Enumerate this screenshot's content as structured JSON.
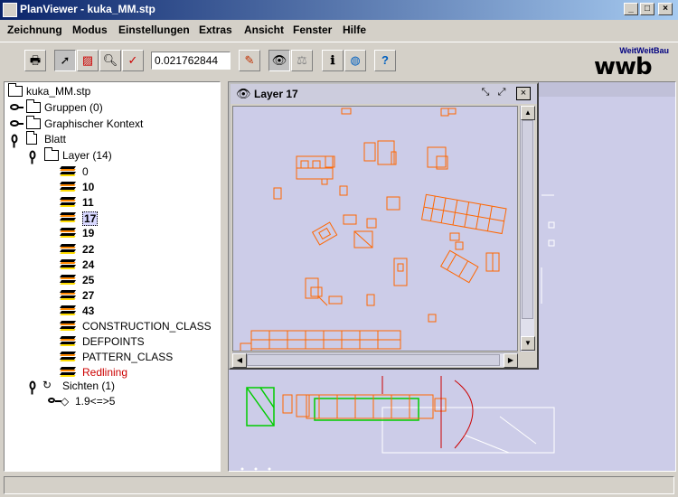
{
  "window": {
    "title": "PlanViewer - kuka_MM.stp"
  },
  "menu": [
    "Zeichnung",
    "Modus",
    "Einstellungen",
    "Extras",
    "Ansicht",
    "Fenster",
    "Hilfe"
  ],
  "toolbar": {
    "zoom_value": "0.021762844",
    "logo_small": "WeitWeitBau",
    "logo_big": "wwb",
    "icons": [
      "printer-icon",
      "select-arrow-icon",
      "select-region-icon",
      "zoom-icon",
      "redline-tool-icon",
      "paint-brush-icon",
      "binoculars-icon",
      "compare-icon",
      "info-icon",
      "globe-icon",
      "help-icon"
    ]
  },
  "tree": {
    "root": "kuka_MM.stp",
    "groups": "Gruppen (0)",
    "graphic_context": "Graphischer Kontext",
    "sheet": "Blatt",
    "layers_label": "Layer (14)",
    "layers": [
      {
        "name": "0",
        "bold": false,
        "color": "#000000"
      },
      {
        "name": "10",
        "bold": true,
        "color": "#000000"
      },
      {
        "name": "11",
        "bold": true,
        "color": "#000000"
      },
      {
        "name": "17",
        "bold": true,
        "color": "#000000",
        "selected": true
      },
      {
        "name": "19",
        "bold": true,
        "color": "#000000"
      },
      {
        "name": "22",
        "bold": true,
        "color": "#000000"
      },
      {
        "name": "24",
        "bold": true,
        "color": "#000000"
      },
      {
        "name": "25",
        "bold": true,
        "color": "#000000"
      },
      {
        "name": "27",
        "bold": true,
        "color": "#000000"
      },
      {
        "name": "43",
        "bold": true,
        "color": "#000000"
      },
      {
        "name": "CONSTRUCTION_CLASS",
        "bold": false,
        "color": "#000000"
      },
      {
        "name": "DEFPOINTS",
        "bold": false,
        "color": "#000000"
      },
      {
        "name": "PATTERN_CLASS",
        "bold": false,
        "color": "#000000"
      },
      {
        "name": "Redlining",
        "bold": false,
        "color": "#cc0000"
      }
    ],
    "views": "Sichten (1)",
    "view_item": "1.9<=>5"
  },
  "internal_frame": {
    "title": "Layer 17"
  },
  "colors": {
    "drawing_orange": "#ff6600",
    "canvas_bg": "#cccce8",
    "title_blue": "#0a246a"
  }
}
